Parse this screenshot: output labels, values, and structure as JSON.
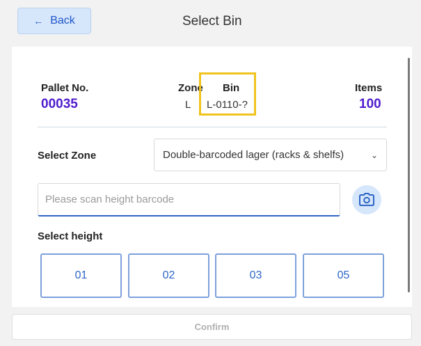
{
  "header": {
    "back_label": "Back",
    "title": "Select Bin"
  },
  "info": {
    "pallet_label": "Pallet No.",
    "pallet_value": "00035",
    "zone_label": "Zone",
    "zone_value": "L",
    "bin_label": "Bin",
    "bin_value": "L-0110-?",
    "items_label": "Items",
    "items_value": "100"
  },
  "zone_select": {
    "label": "Select Zone",
    "selected": "Double-barcoded lager (racks & shelfs)"
  },
  "scan": {
    "placeholder": "Please scan height barcode",
    "value": ""
  },
  "heights": {
    "label": "Select height",
    "options": [
      "01",
      "02",
      "03",
      "05"
    ]
  },
  "footer": {
    "confirm_label": "Confirm"
  },
  "colors": {
    "accent": "#2e66c6",
    "value_purple": "#4f1ccd",
    "highlight": "#f0c31c"
  }
}
